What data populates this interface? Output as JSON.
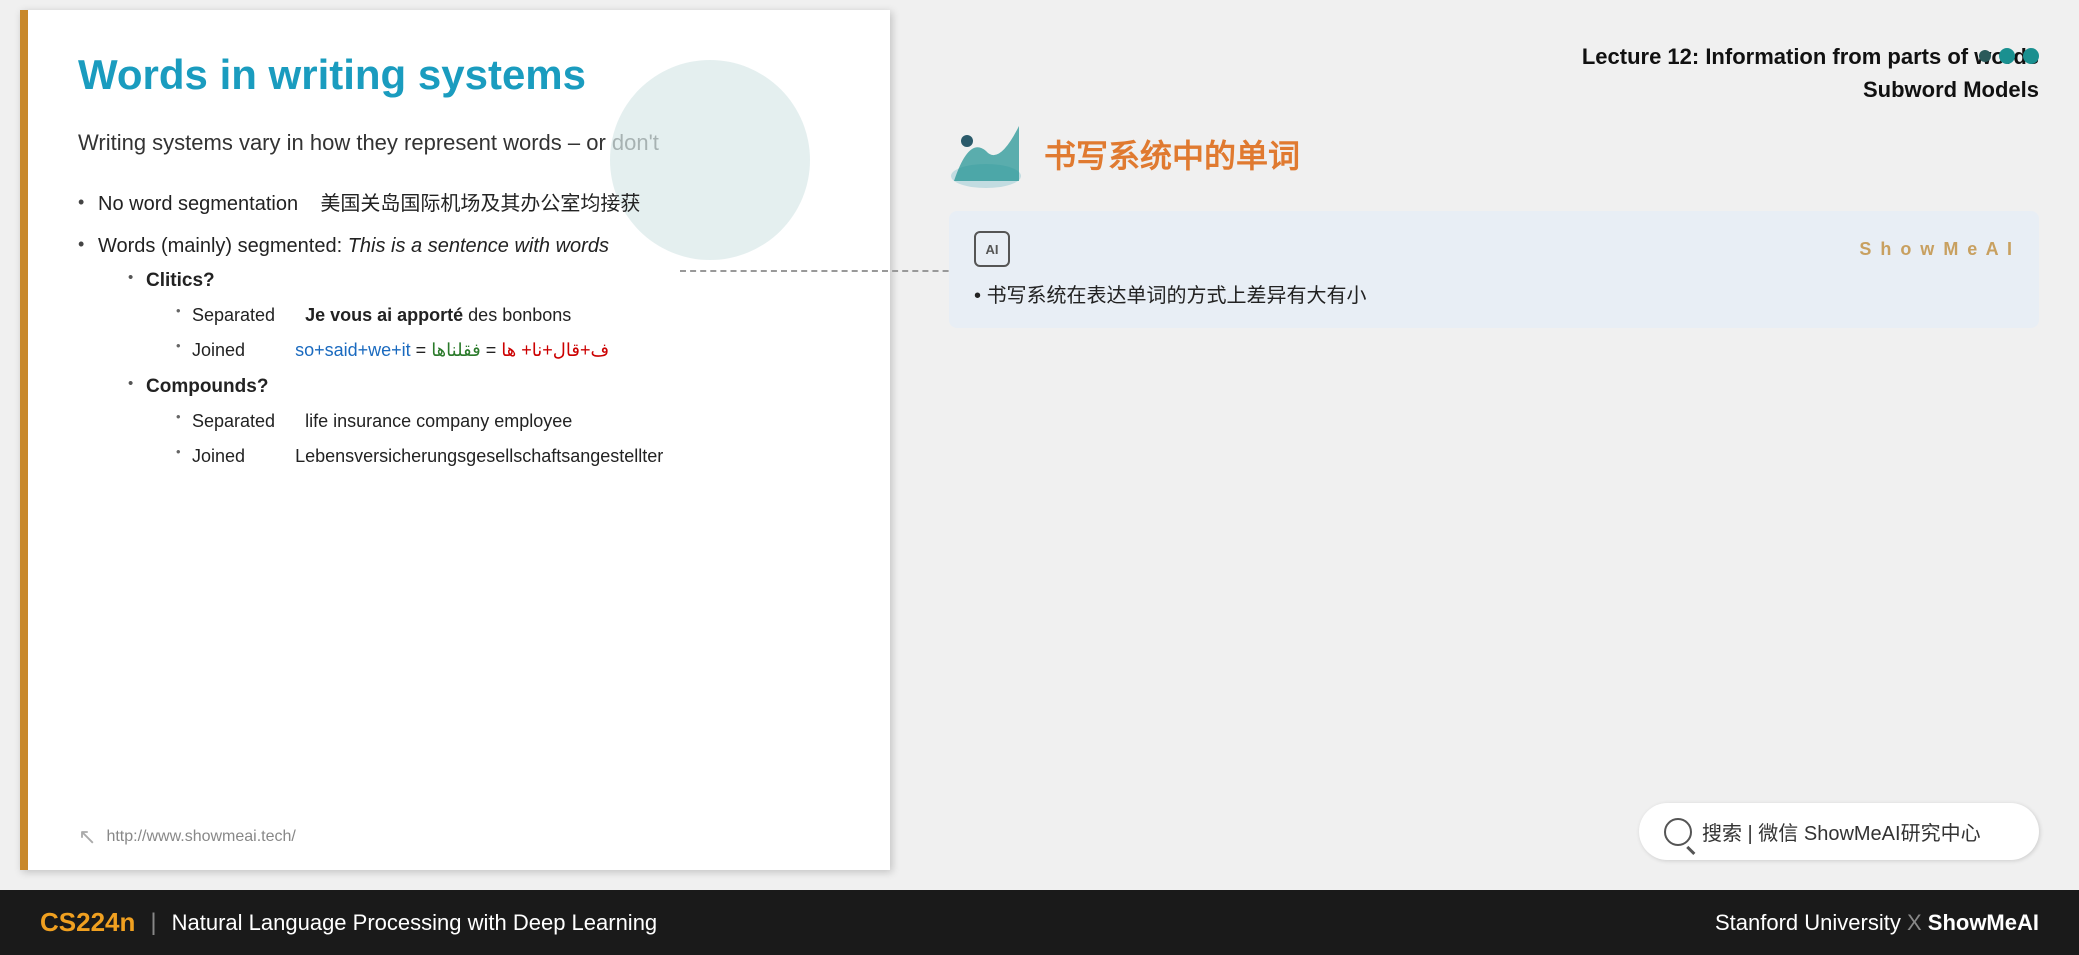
{
  "lecture": {
    "title_line1": "Lecture 12: Information from parts of words",
    "title_line2": "Subword Models"
  },
  "slide": {
    "title": "Words in writing systems",
    "intro": "Writing systems vary in how they represent words – or don't",
    "bullets": [
      {
        "text": "No word segmentation",
        "chinese": "美国关岛国际机场及其办公室均接获"
      },
      {
        "text": "Words (mainly) segmented:",
        "example": "This is a sentence with words",
        "sub_items": [
          {
            "label": "Clitics?",
            "items": [
              {
                "type": "Separated",
                "example_bold": "Je vous ai apporté",
                "example_rest": " des bonbons"
              },
              {
                "type": "Joined",
                "formula": "so+said+we+it = ف+قال+نا+ ها = فقلناها"
              }
            ]
          },
          {
            "label": "Compounds?",
            "items": [
              {
                "type": "Separated",
                "example": "life insurance company employee"
              },
              {
                "type": "Joined",
                "example": "Lebensversicherungsgesellschaftsangestellter"
              }
            ]
          }
        ]
      }
    ],
    "footer_url": "http://www.showmeai.tech/"
  },
  "translation_card": {
    "ai_label": "AI",
    "brand_label": "S h o w M e A I",
    "content": "书写系统在表达单词的方式上差异有大有小"
  },
  "right_title": {
    "chinese": "书写系统中的单词"
  },
  "search": {
    "text": "搜索 | 微信 ShowMeAI研究中心"
  },
  "bottom_bar": {
    "course_code": "CS224n",
    "separator": "|",
    "course_name": "Natural Language Processing with Deep Learning",
    "university": "Stanford University",
    "x": "X",
    "brand": "ShowMeAI"
  },
  "nav_dots": [
    {
      "color": "dark"
    },
    {
      "color": "teal"
    },
    {
      "color": "teal"
    }
  ]
}
